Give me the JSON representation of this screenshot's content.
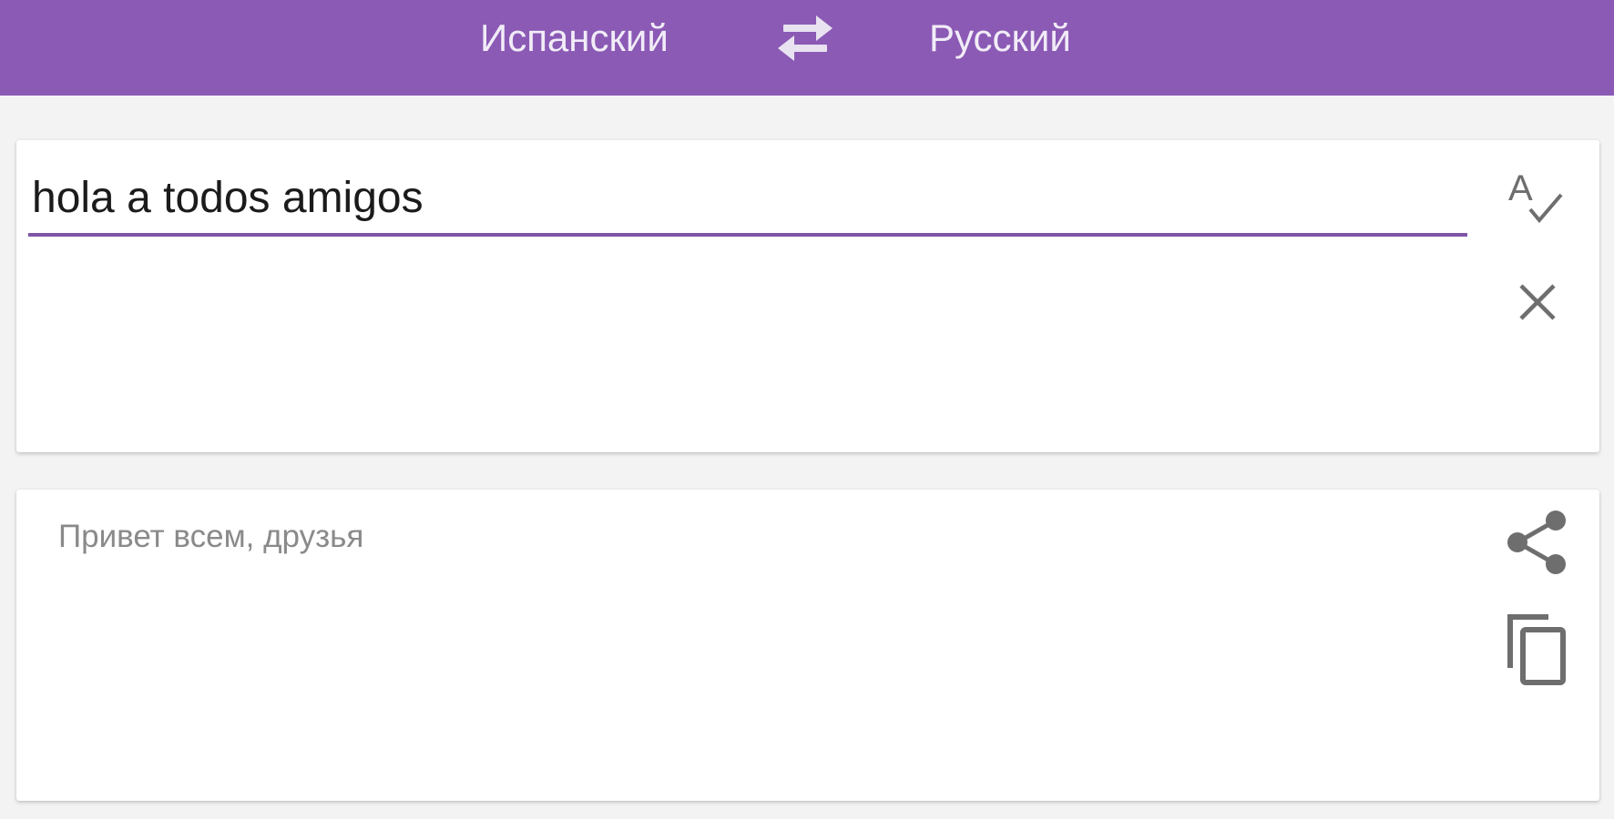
{
  "header": {
    "source_language": "Испанский",
    "target_language": "Русский",
    "swap_icon": "swap-arrows-icon"
  },
  "input": {
    "text": "hola a todos amigos",
    "spellcheck_icon": "spellcheck-icon",
    "clear_icon": "close-icon"
  },
  "output": {
    "translation": "Привет всем, друзья",
    "share_icon": "share-icon",
    "copy_icon": "copy-icon"
  },
  "colors": {
    "accent": "#8b5ab5",
    "underline": "#7f55a6",
    "icon": "#6e6e6e",
    "translation_text": "#8a8a8a"
  }
}
